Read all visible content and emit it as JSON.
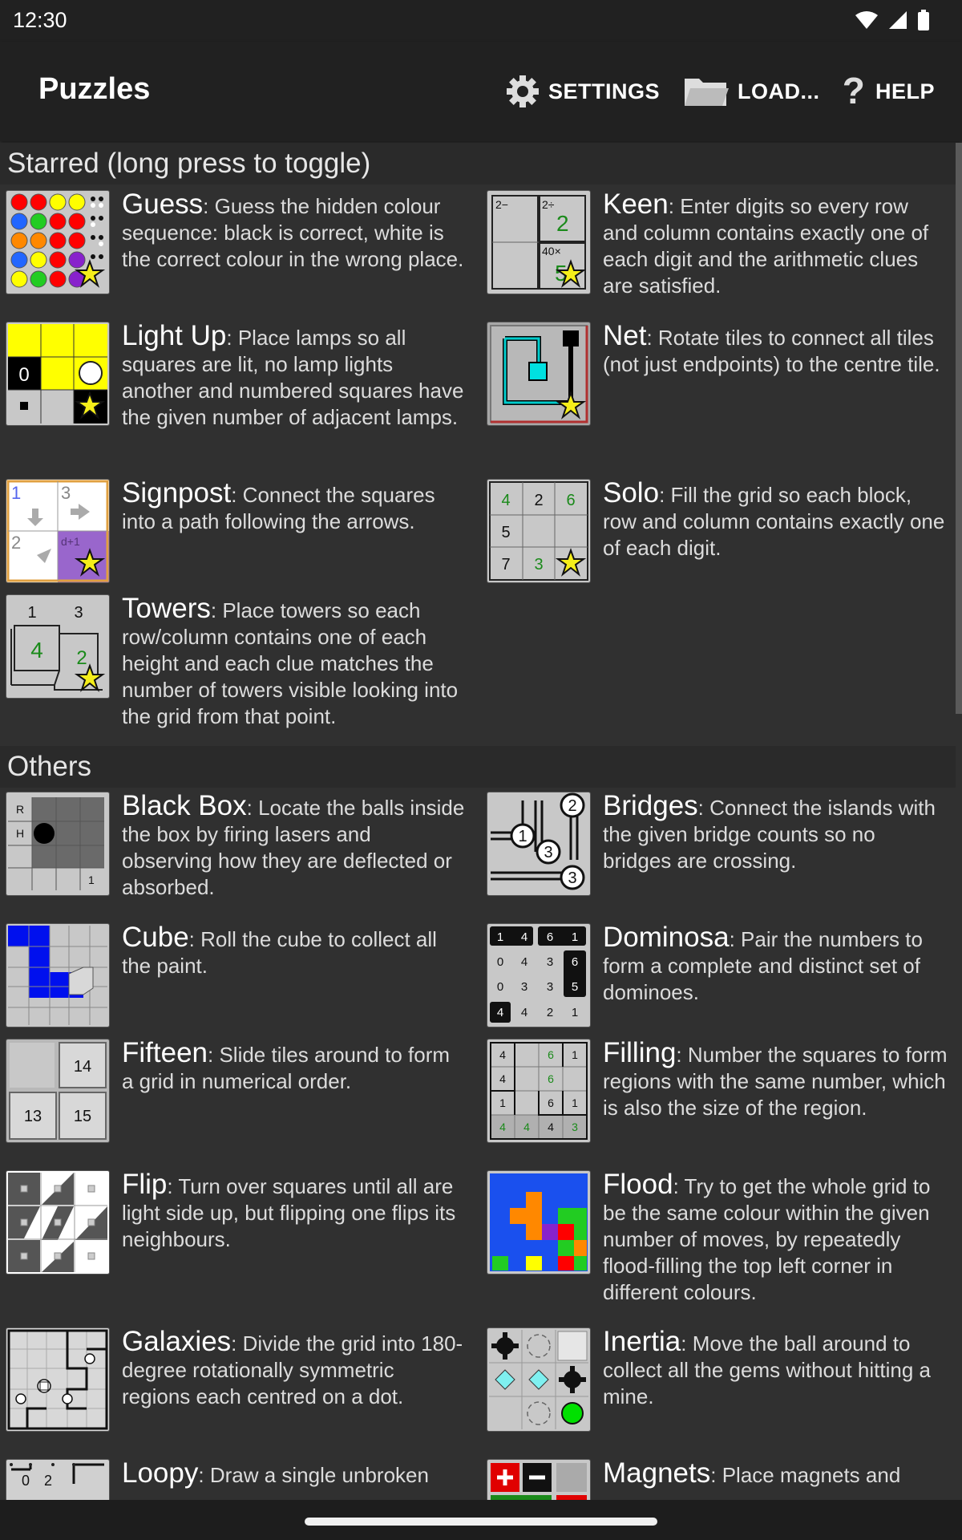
{
  "status": {
    "time": "12:30"
  },
  "app": {
    "title": "Puzzles"
  },
  "actions": {
    "settings": "SETTINGS",
    "load": "LOAD...",
    "help": "HELP"
  },
  "sections": {
    "starred": "Starred (long press to toggle)",
    "others": "Others"
  },
  "starred": [
    {
      "name": "Guess",
      "desc": ": Guess the hidden colour sequence: black is correct, white is the correct colour in the wrong place."
    },
    {
      "name": "Keen",
      "desc": ": Enter digits so every row and column contains exactly one of each digit and the arithmetic clues are satisfied."
    },
    {
      "name": "Light Up",
      "desc": ": Place lamps so all squares are lit, no lamp lights another and numbered squares have the given number of adjacent lamps."
    },
    {
      "name": "Net",
      "desc": ": Rotate tiles to connect all tiles (not just endpoints) to the centre tile."
    },
    {
      "name": "Signpost",
      "desc": ": Connect the squares into a path following the arrows."
    },
    {
      "name": "Solo",
      "desc": ": Fill the grid so each block, row and column contains exactly one of each digit."
    },
    {
      "name": "Towers",
      "desc": ": Place towers so each row/column contains one of each height and each clue matches the number of towers visible looking into the grid from that point."
    }
  ],
  "others": [
    {
      "name": "Black Box",
      "desc": ": Locate the balls inside the box by firing lasers and observing how they are deflected or absorbed."
    },
    {
      "name": "Bridges",
      "desc": ": Connect the islands with the given bridge counts so no bridges are crossing."
    },
    {
      "name": "Cube",
      "desc": ": Roll the cube to collect all the paint."
    },
    {
      "name": "Dominosa",
      "desc": ": Pair the numbers to form a complete and distinct set of dominoes."
    },
    {
      "name": "Fifteen",
      "desc": ": Slide tiles around to form a grid in numerical order."
    },
    {
      "name": "Filling",
      "desc": ": Number the squares to form regions with the same number, which is also the size of the region."
    },
    {
      "name": "Flip",
      "desc": ": Turn over squares until all are light side up, but flipping one flips its neighbours."
    },
    {
      "name": "Flood",
      "desc": ": Try to get the whole grid to be the same colour within the given number of moves, by repeatedly flood-filling the top left corner in different colours."
    },
    {
      "name": "Galaxies",
      "desc": ": Divide the grid into 180-degree rotationally symmetric regions each centred on a dot."
    },
    {
      "name": "Inertia",
      "desc": ": Move the ball around to collect all the gems without hitting a mine."
    },
    {
      "name": "Loopy",
      "desc": ": Draw a single unbroken"
    },
    {
      "name": "Magnets",
      "desc": ": Place magnets and"
    }
  ],
  "thumbs": {
    "keen": {
      "c1": "2−",
      "c2": "2÷",
      "c3": "40×",
      "v2": "2",
      "v3": "5"
    },
    "lightup": {
      "n": "0"
    },
    "signpost": {
      "a": "1",
      "b": "3",
      "c": "2",
      "d": "d+1"
    },
    "solo": {
      "r1": [
        "4",
        "2",
        "6"
      ],
      "r2": [
        "5"
      ],
      "r3": [
        "7",
        "3"
      ]
    },
    "towers": {
      "t1": "1",
      "t2": "3",
      "v1": "4",
      "v2": "2"
    },
    "blackbox": {
      "r": "R",
      "h": "H",
      "one": "1"
    },
    "bridges": {
      "a": "2",
      "b": "1",
      "c": "3",
      "d": "3"
    },
    "dominosa": {
      "rows": [
        [
          "1",
          "4",
          "6",
          "1"
        ],
        [
          "0",
          "4",
          "3",
          "6"
        ],
        [
          "0",
          "3",
          "3",
          "5"
        ],
        [
          "4",
          "4",
          "2",
          "1"
        ]
      ]
    },
    "fifteen": {
      "a": "14",
      "b": "13",
      "c": "15"
    },
    "filling": {
      "rows": [
        [
          "4",
          "",
          "6",
          "1"
        ],
        [
          "4",
          "",
          "6",
          ""
        ],
        [
          "1",
          "",
          "6",
          "1"
        ],
        [
          "4",
          "4",
          "4",
          "3"
        ]
      ]
    },
    "loopy": {
      "a": "0",
      "b": "2"
    }
  },
  "colors": {
    "background": "#303030",
    "bar": "#212121",
    "section": "#2a2a2a",
    "star": "#f5ee1a"
  }
}
